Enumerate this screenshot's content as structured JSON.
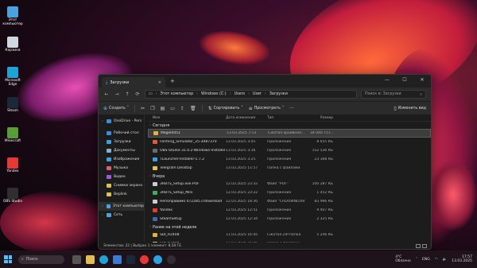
{
  "desktop_icons": [
    {
      "label": "Этот компьютер",
      "color": "#4aa3df"
    },
    {
      "label": "Корзина",
      "color": "#cfd8e0"
    },
    {
      "label": "Microsoft Edge",
      "color": "#1fa3d6"
    },
    {
      "label": "Steam",
      "color": "#1b2838"
    },
    {
      "label": "Minecraft",
      "color": "#5a9b3a"
    },
    {
      "label": "Yandex",
      "color": "#e53935"
    },
    {
      "label": "OBS Studio",
      "color": "#302e31"
    }
  ],
  "window": {
    "tab_title": "Загрузки",
    "breadcrumb": [
      "Этот компьютер",
      "Windows (C:)",
      "Users",
      "User",
      "Загрузки"
    ],
    "search_placeholder": "Поиск в: Загрузки",
    "commands": {
      "create": "Создать",
      "sort": "Сортировать",
      "view": "Просмотреть",
      "details": "Изменить вид"
    }
  },
  "sidebar": [
    {
      "label": "OneDrive - Pers",
      "color": "#3a8fd8",
      "expand": true
    },
    {
      "label": "Рабочий стол",
      "color": "#3a8fd8"
    },
    {
      "label": "Загрузки",
      "color": "#3aa0e0"
    },
    {
      "label": "Документы",
      "color": "#8ab0d0"
    },
    {
      "label": "Изображения",
      "color": "#3aa0e0"
    },
    {
      "label": "Музыка",
      "color": "#e05a7a"
    },
    {
      "label": "Видео",
      "color": "#a05ae0"
    },
    {
      "label": "Снимки экрана",
      "color": "#e0c050"
    },
    {
      "label": "Beplink",
      "color": "#e0c050"
    },
    {
      "label": "Этот компьютер",
      "color": "#4aa3df",
      "expand": true,
      "selected": true
    },
    {
      "label": "Сеть",
      "color": "#4aa3df",
      "expand": true
    }
  ],
  "columns": [
    "Имя",
    "Дата изменения",
    "Тип",
    "Размер"
  ],
  "groups": [
    {
      "title": "Сегодня",
      "rows": [
        {
          "name": "Magel4451",
          "date": "13.03.2025 7:13",
          "type": "Сжатая архивная...",
          "size": "18 040 757...",
          "color": "#e0b040",
          "selected": true
        },
        {
          "name": "Farming_Simulator_25-3087370",
          "date": "13.03.2025 3:45",
          "type": "Приложение",
          "size": "8 655 КБ",
          "color": "#e05a3a"
        },
        {
          "name": "OBS-Studio-31.0.2-Windows-Installer",
          "date": "13.03.2025 3:36",
          "type": "Приложение",
          "size": "152 536 КБ",
          "color": "#6a6a6a"
        },
        {
          "name": "TLauncher-Installer-1.7.2",
          "date": "13.03.2025 3:25",
          "type": "Приложение",
          "size": "23 308 КБ",
          "color": "#3aa0e0"
        },
        {
          "name": "Telegram Desktop",
          "date": "13.03.2025 11:57",
          "type": "Папка с файлами",
          "size": "",
          "color": "#e0c050"
        }
      ]
    },
    {
      "title": "Вчера",
      "rows": [
        {
          "name": "3RBTS_Setup.exe.POF",
          "date": "12.03.2025 23:32",
          "type": "Файл \"POF\"",
          "size": "100 287 КБ",
          "color": "#cccccc"
        },
        {
          "name": "3RBTS_Setup_Mini",
          "date": "12.03.2025 23:22",
          "type": "Приложение",
          "size": "1 452 КБ",
          "color": "#3ab05a"
        },
        {
          "name": "Непоправимо 472285.crdownload",
          "date": "12.03.2025 18:30",
          "type": "Файл \"CRDOWNLOAD\"",
          "size": "83 996 КБ",
          "color": "#cccccc"
        },
        {
          "name": "Yandex",
          "date": "12.03.2025 12:51",
          "type": "Приложение",
          "size": "9 407 КБ",
          "color": "#e53935"
        },
        {
          "name": "SteamSetup",
          "date": "12.03.2025 12:34",
          "type": "Приложение",
          "size": "2 325 КБ",
          "color": "#3a6ab0"
        }
      ]
    },
    {
      "title": "Ранее на этой неделе",
      "rows": [
        {
          "name": "SDI_R2408",
          "date": "11.03.2025 16:45",
          "type": "Сжатая ZIP-папка",
          "size": "5 246 КБ",
          "color": "#e0b040"
        },
        {
          "name": "SDI_R2408",
          "date": "11.03.2025 16:45",
          "type": "Папка с файлами",
          "size": "",
          "color": "#e0c050"
        }
      ]
    }
  ],
  "status_bar": "Элементов: 22  |  Выбран 1 элемент: 8,58 ГБ",
  "taskbar": {
    "search": "Поиск",
    "weather_temp": "4°C",
    "weather_text": "Облачно",
    "lang": "ENG",
    "time": "17:57",
    "date": "13.03.2025"
  }
}
